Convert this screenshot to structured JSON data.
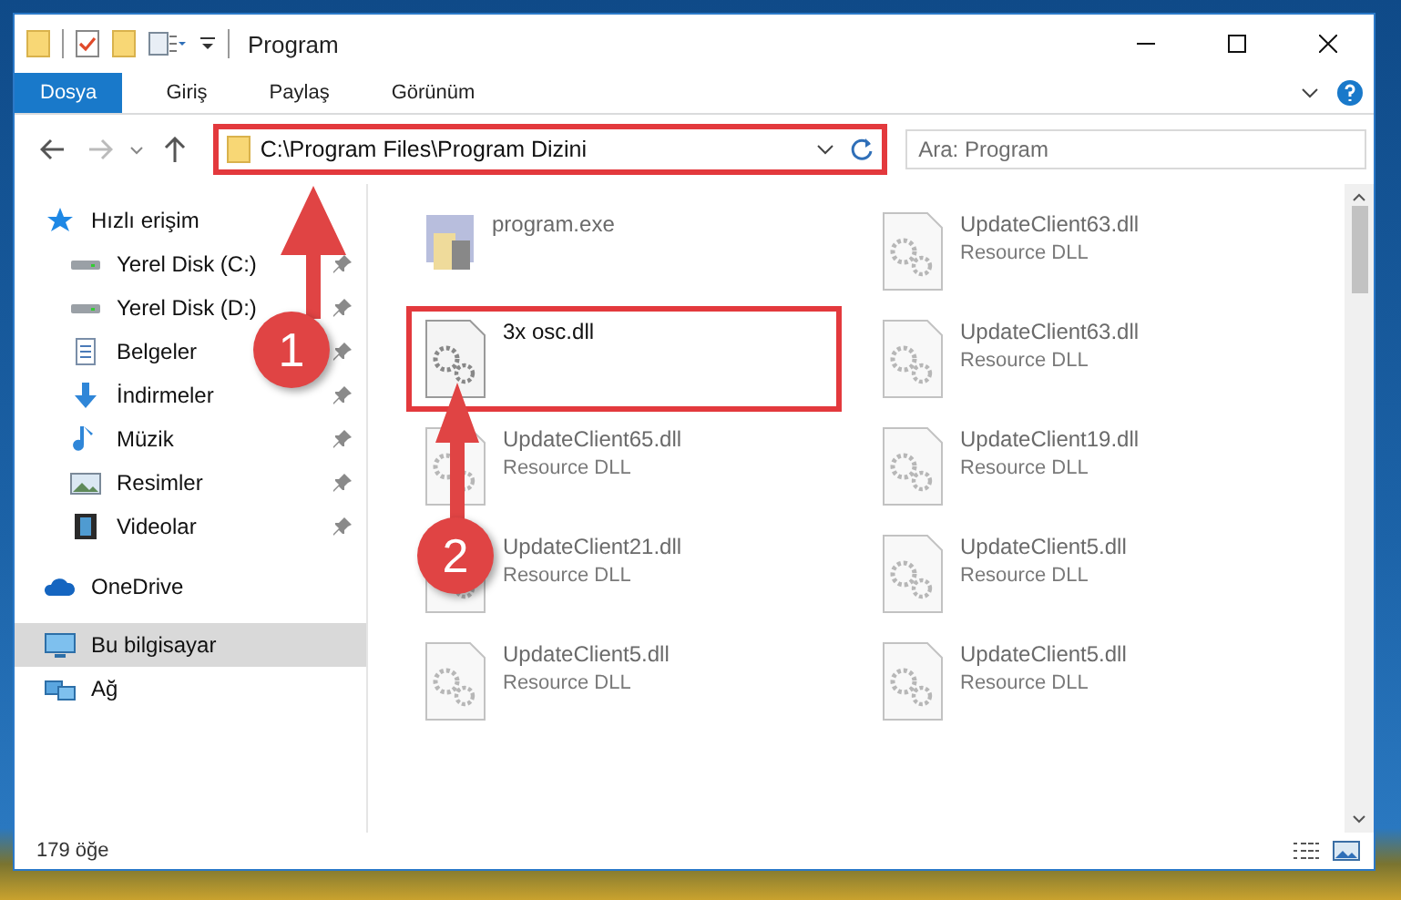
{
  "window": {
    "title": "Program"
  },
  "ribbon_tabs": [
    {
      "label": "Dosya",
      "kind": "file"
    },
    {
      "label": "Giriş",
      "kind": "tab"
    },
    {
      "label": "Paylaş",
      "kind": "tab"
    },
    {
      "label": "Görünüm",
      "kind": "tab"
    }
  ],
  "address": {
    "path": "C:\\Program Files\\Program Dizini",
    "highlighted": true
  },
  "search": {
    "placeholder": "Ara: Program"
  },
  "sidebar": {
    "items": [
      {
        "label": "Hızlı erişim",
        "selected": false,
        "children": [
          {
            "label": "Yerel Disk (C:)",
            "pinned": true,
            "selected": false
          },
          {
            "label": "Yerel Disk (D:)",
            "pinned": true,
            "selected": false
          },
          {
            "label": "Belgeler",
            "pinned": true,
            "selected": false
          },
          {
            "label": "İndirmeler",
            "pinned": true,
            "selected": false
          },
          {
            "label": "Müzik",
            "pinned": true,
            "selected": false
          },
          {
            "label": "Resimler",
            "pinned": true,
            "selected": false
          },
          {
            "label": "Videolar",
            "pinned": true,
            "selected": false
          }
        ]
      },
      {
        "label": "OneDrive",
        "selected": false
      },
      {
        "label": "Bu bilgisayar",
        "selected": true
      },
      {
        "label": "Ağ",
        "selected": false
      }
    ]
  },
  "files": [
    {
      "name": "program.exe",
      "kind": "exe",
      "dimmed": true,
      "highlighted": false
    },
    {
      "name": "UpdateClient63.dll",
      "type": "Resource DLL",
      "kind": "dll",
      "dimmed": true,
      "highlighted": false
    },
    {
      "name": "3x osc.dll",
      "kind": "dll",
      "dimmed": false,
      "highlighted": true
    },
    {
      "name": "UpdateClient63.dll",
      "type": "Resource DLL",
      "kind": "dll",
      "dimmed": true,
      "highlighted": false
    },
    {
      "name": "UpdateClient65.dll",
      "type": "Resource DLL",
      "kind": "dll",
      "dimmed": true,
      "highlighted": false
    },
    {
      "name": "UpdateClient19.dll",
      "type": "Resource DLL",
      "kind": "dll",
      "dimmed": true,
      "highlighted": false
    },
    {
      "name": "UpdateClient21.dll",
      "type": "Resource DLL",
      "kind": "dll",
      "dimmed": true,
      "highlighted": false
    },
    {
      "name": "UpdateClient5.dll",
      "type": "Resource DLL",
      "kind": "dll",
      "dimmed": true,
      "highlighted": false
    },
    {
      "name": "UpdateClient5.dll",
      "type": "Resource DLL",
      "kind": "dll",
      "dimmed": true,
      "highlighted": false
    },
    {
      "name": "UpdateClient5.dll",
      "type": "Resource DLL",
      "kind": "dll",
      "dimmed": true,
      "highlighted": false
    }
  ],
  "status_bar": {
    "count": "179 öğe"
  },
  "annotations": [
    {
      "number": "1"
    },
    {
      "number": "2"
    }
  ]
}
